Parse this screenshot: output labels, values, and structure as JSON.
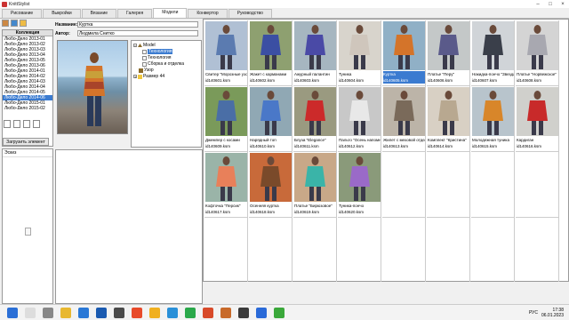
{
  "window": {
    "title": "KnittStylist"
  },
  "tabs": [
    "Рисование",
    "Выкройки",
    "Вязание",
    "Галерея",
    "Модели",
    "Конвертор",
    "Руководство"
  ],
  "active_tab": 4,
  "collections": {
    "header": "Коллекция",
    "items": [
      "Любо-Дело 2013-01",
      "Любо-Дело 2013-02",
      "Любо-Дело 2013-03",
      "Любо-Дело 2013-04",
      "Любо-Дело 2013-05",
      "Любо-Дело 2013-06",
      "Любо-Дело 2014-01",
      "Любо-Дело 2014-02",
      "Любо-Дело 2014-03",
      "Любо-Дело 2014-04",
      "Любо-Дело 2014-05",
      "Любо-Дело 2014-06",
      "Любо-Дело 2015-01",
      "Любо-Дело 2015-02"
    ],
    "selected_index": 11,
    "load_button": "Загрузить элемент",
    "sketch_label": "Эскиз"
  },
  "details": {
    "name_label": "Название:",
    "name_value": "Куртка",
    "author_label": "Автор:",
    "author_value": "Людмила Снитко"
  },
  "tree": {
    "root": "Model",
    "children": [
      "Технология",
      "Технология",
      "Сборка и отделка",
      "Узор",
      "Размер 44"
    ],
    "selected_index": 0
  },
  "gallery": {
    "items": [
      {
        "caption": "Свитер \"Морозные узоры\"",
        "id": "id140601.ksm",
        "top": "#5b7bb0",
        "bg": "#b0c0d4"
      },
      {
        "caption": "Жакет с карманами",
        "id": "id140602.ksm",
        "top": "#3b4fa3",
        "bg": "#8ea070"
      },
      {
        "caption": "Ажурный палантин",
        "id": "id140603.ksm",
        "top": "#4a4aa6",
        "bg": "#a6b6c0"
      },
      {
        "caption": "Туника",
        "id": "id140604.ksm",
        "top": "#cfc6bc",
        "bg": "#d8d4cc"
      },
      {
        "caption": "Куртка",
        "id": "id140605.ksm",
        "top": "#d4742a",
        "bg": "#90b0c6"
      },
      {
        "caption": "Платье \"Перу\"",
        "id": "id140606.ksm",
        "top": "#5a5a8a",
        "bg": "#c4c8c8"
      },
      {
        "caption": "Накидка-пончо \"Звезда\"",
        "id": "id140607.ksm",
        "top": "#3a3f4a",
        "bg": "#d0d4d8"
      },
      {
        "caption": "Платье \"Норвежское\"",
        "id": "id140608.ksm",
        "top": "#a8a8b0",
        "bg": "#d4d4d4"
      },
      {
        "caption": "Джемпер с косами",
        "id": "id140609.ksm",
        "top": "#4a6ea6",
        "bg": "#7a9a5a"
      },
      {
        "caption": "Нарядный топ",
        "id": "id140610.ksm",
        "top": "#4a78c8",
        "bg": "#90a8b4"
      },
      {
        "caption": "Блуза \"Elegance\"",
        "id": "id140611.ksm",
        "top": "#cc2a2a",
        "bg": "#9a9a80"
      },
      {
        "caption": "Пальто \"Осень напомнит\"",
        "id": "id140612.ksm",
        "top": "#e8e8e8",
        "bg": "#c8c8c8"
      },
      {
        "caption": "Жилет с меховой отделкой",
        "id": "id140613.ksm",
        "top": "#7a6a5a",
        "bg": "#bcb4a8"
      },
      {
        "caption": "Комплект \"Кристина\"",
        "id": "id140614.ksm",
        "top": "#b8a890",
        "bg": "#d8d0c4"
      },
      {
        "caption": "Молодежная туника",
        "id": "id140615.ksm",
        "top": "#d8862a",
        "bg": "#b8c4cc"
      },
      {
        "caption": "Кардиган",
        "id": "id140616.ksm",
        "top": "#c82a2a",
        "bg": "#d0d0cc"
      },
      {
        "caption": "Кофточка \"Персик\"",
        "id": "id140617.ksm",
        "top": "#e8805a",
        "bg": "#9ab4a8"
      },
      {
        "caption": "Осенняя куртка",
        "id": "id140618.ksm",
        "top": "#7a4a2a",
        "bg": "#c86a3a"
      },
      {
        "caption": "Платье \"Бирюзовое\"",
        "id": "id140619.ksm",
        "top": "#3ab4a8",
        "bg": "#c8a888"
      },
      {
        "caption": "Туника-пончо",
        "id": "id140620.ksm",
        "top": "#9a6ac8",
        "bg": "#8a9a7a"
      }
    ],
    "selected_index": 4
  },
  "taskbar": {
    "lang": "РУС",
    "time": "17:38",
    "date": "06.01.2023"
  }
}
